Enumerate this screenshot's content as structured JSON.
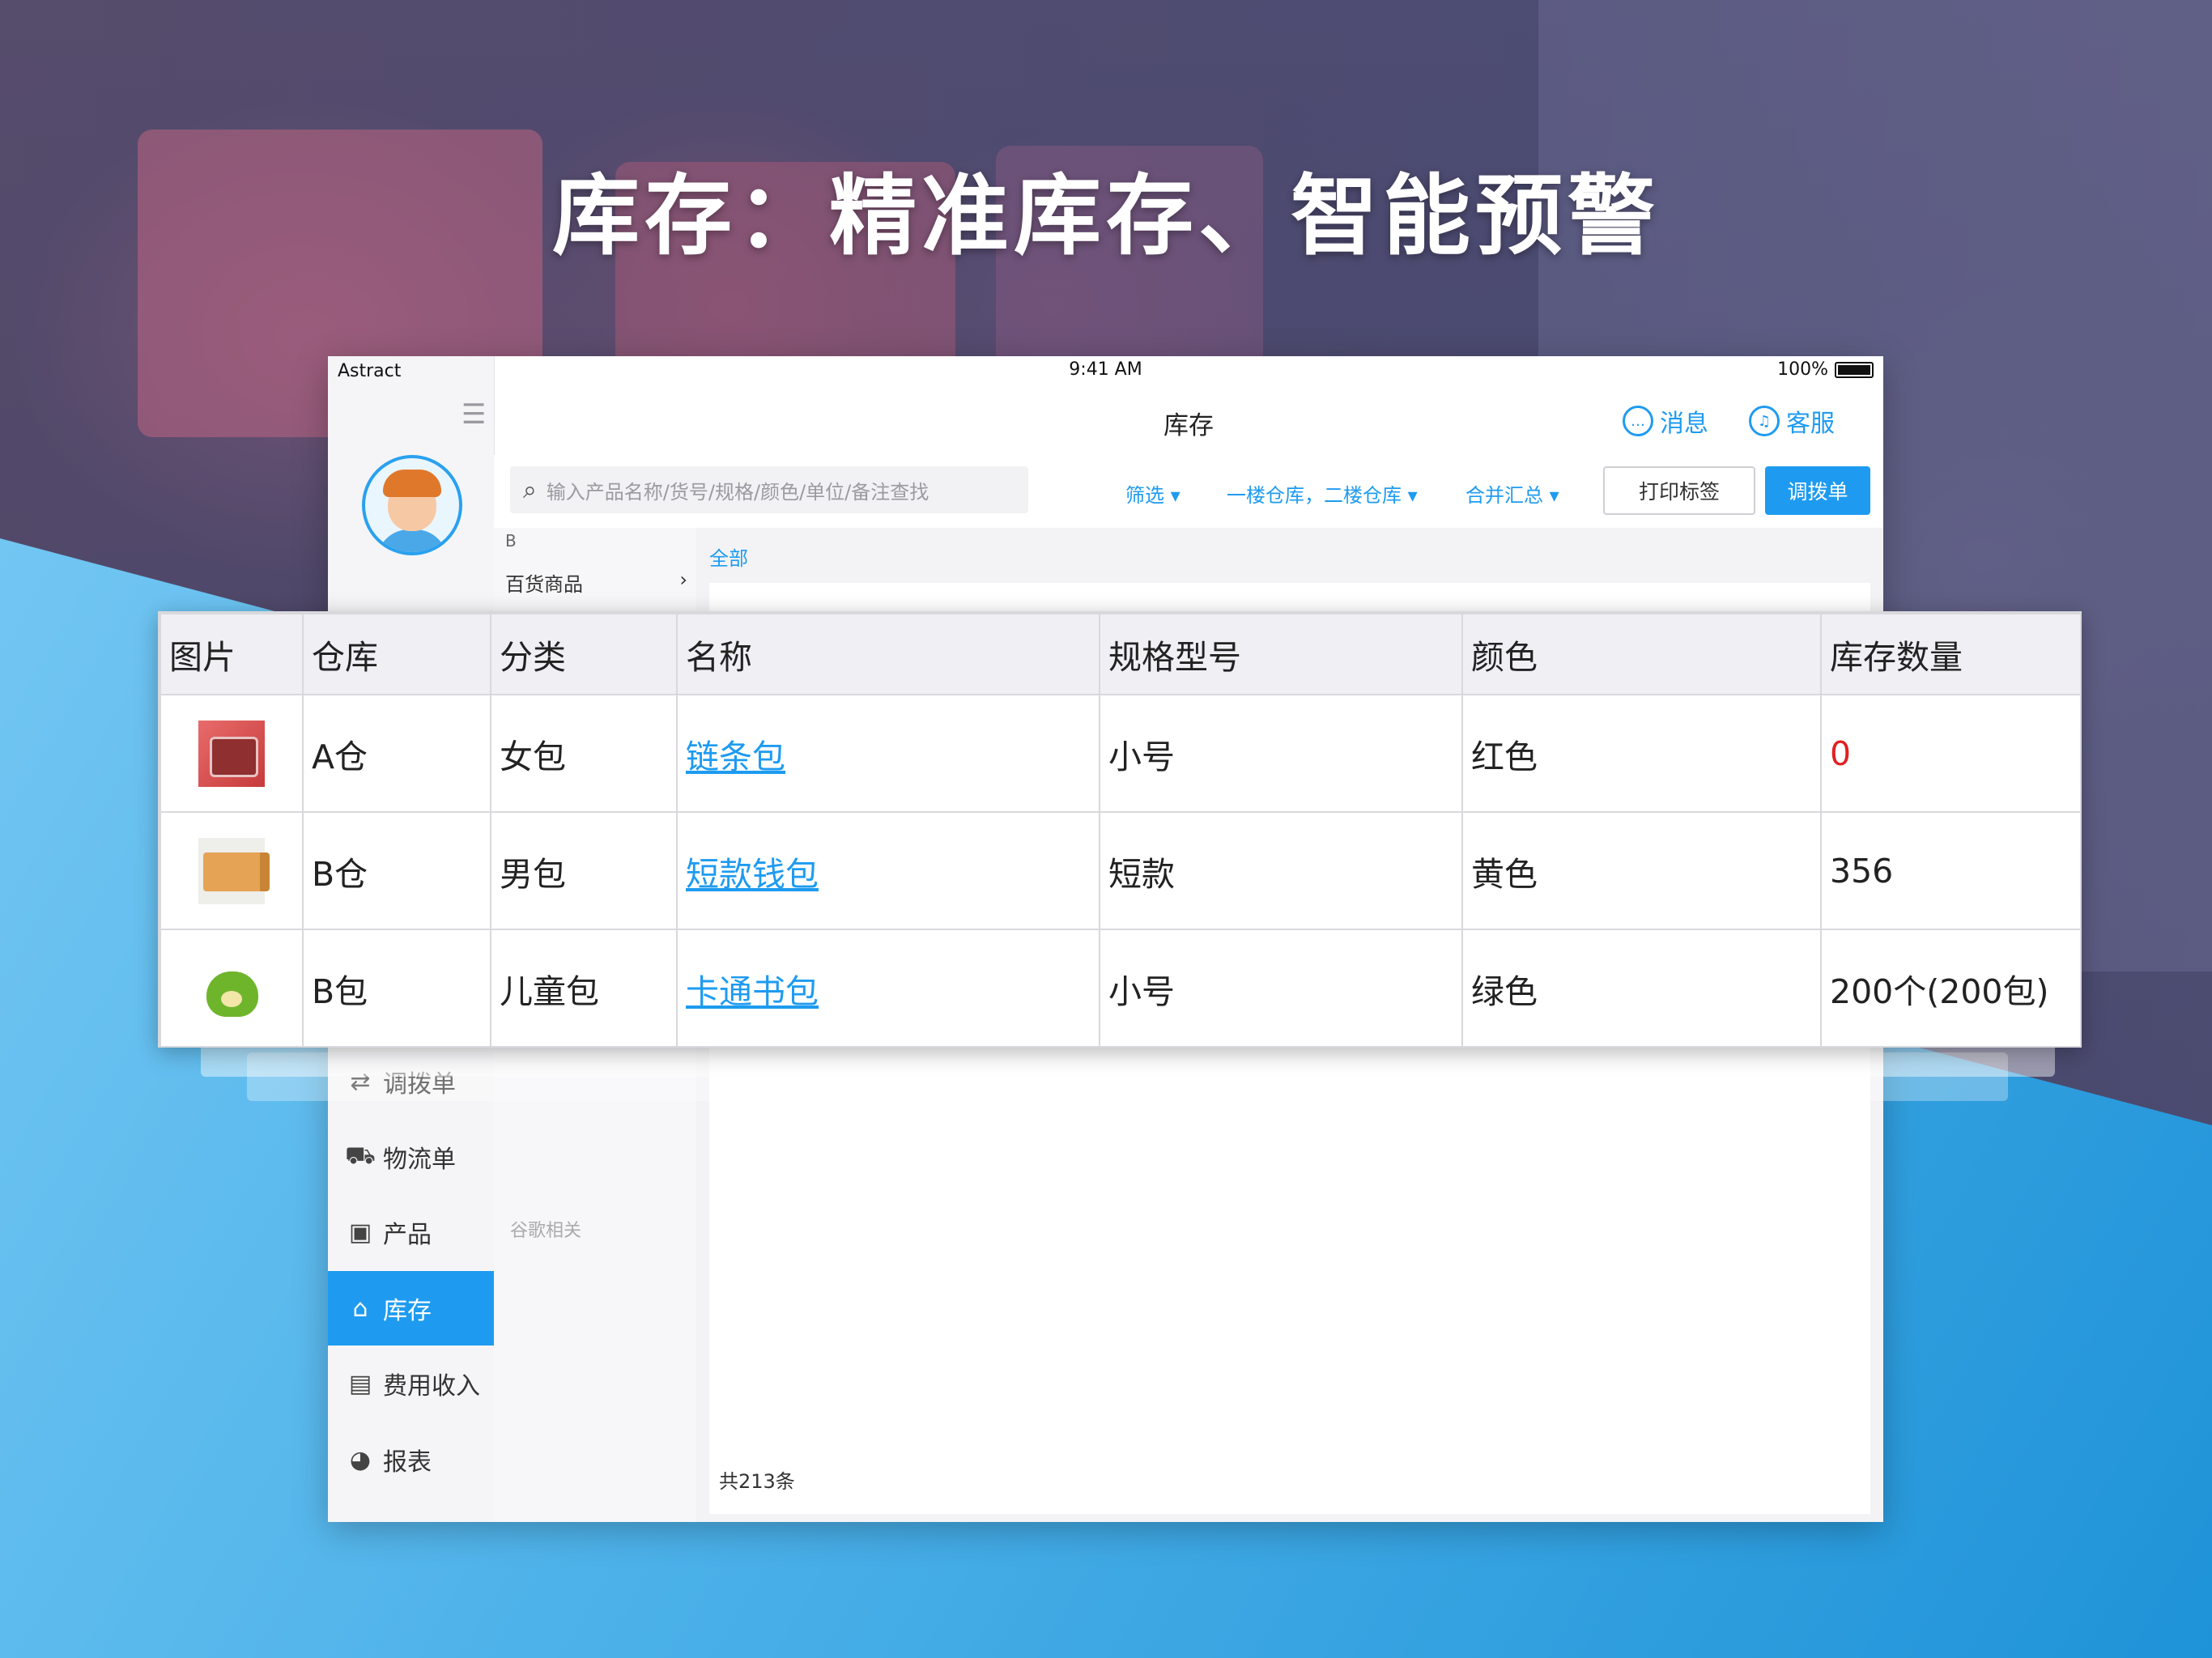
{
  "headline": "库存：精准库存、智能预警",
  "status_bar": {
    "carrier": "Astract",
    "time": "9:41 AM",
    "battery": "100%"
  },
  "header": {
    "title": "库存",
    "messages": "消息",
    "service": "客服"
  },
  "toolbar": {
    "search_placeholder": "输入产品名称/货号/规格/颜色/单位/备注查找",
    "filter": "筛选",
    "warehouses": "一楼仓库，二楼仓库",
    "merge": "合并汇总",
    "print_label": "打印标签",
    "transfer": "调拨单"
  },
  "categories": {
    "letter": "B",
    "item": "百货商品",
    "dim": "谷歌相关"
  },
  "list": {
    "all": "全部",
    "total": "共213条"
  },
  "sidebar": {
    "items": [
      {
        "label": "调拨单",
        "icon": "transfer-icon"
      },
      {
        "label": "物流单",
        "icon": "truck-icon"
      },
      {
        "label": "产品",
        "icon": "box-icon"
      },
      {
        "label": "库存",
        "icon": "warehouse-icon",
        "active": true
      },
      {
        "label": "费用收入",
        "icon": "ledger-icon"
      },
      {
        "label": "报表",
        "icon": "pie-chart-icon"
      }
    ]
  },
  "table": {
    "headers": [
      "图片",
      "仓库",
      "分类",
      "名称",
      "规格型号",
      "颜色",
      "库存数量"
    ],
    "rows": [
      {
        "warehouse": "A仓",
        "category": "女包",
        "name": "链条包",
        "spec": "小号",
        "color": "红色",
        "qty": "0"
      },
      {
        "warehouse": "B仓",
        "category": "男包",
        "name": "短款钱包",
        "spec": "短款",
        "color": "黄色",
        "qty": "356"
      },
      {
        "warehouse": "B包",
        "category": "儿童包",
        "name": "卡通书包",
        "spec": "小号",
        "color": "绿色",
        "qty": "200个(200包)"
      }
    ]
  },
  "colors": {
    "accent": "#1e9bf0",
    "alert": "#e02020"
  }
}
